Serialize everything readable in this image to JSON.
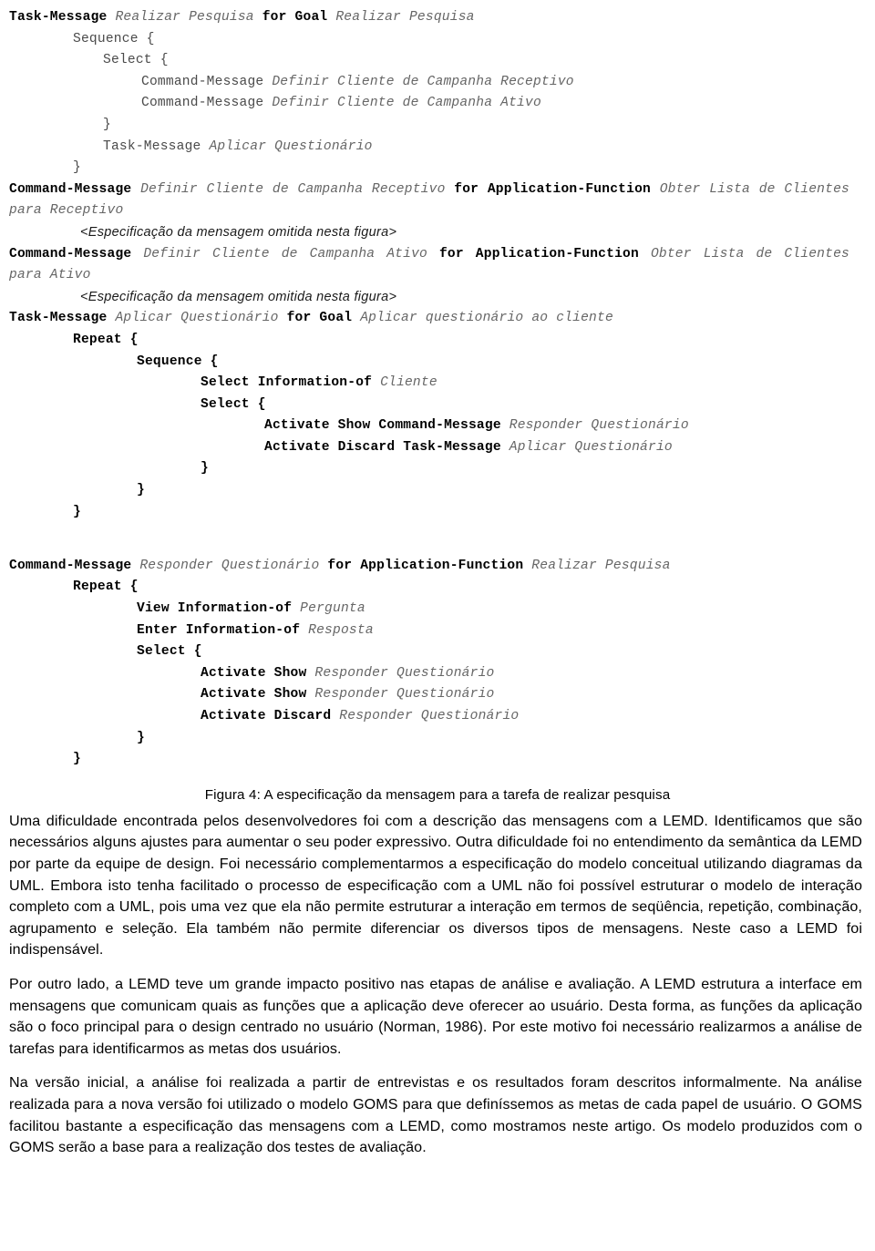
{
  "document": {
    "figure_caption": "Figura 4: A especificação da mensagem para a tarefa de realizar pesquisa",
    "omitted_note": "<Especificação da mensagem omitida nesta figura>"
  },
  "spec": {
    "blocks": [
      {
        "id": "block-task-realizar-pesquisa",
        "lines": [
          {
            "indent": 0,
            "segments": [
              {
                "t": "kw",
                "v": "Task-Message"
              },
              {
                "t": "val",
                "v": " Realizar Pesquisa "
              },
              {
                "t": "kw",
                "v": "for Goal"
              },
              {
                "t": "val",
                "v": " Realizar Pesquisa"
              }
            ]
          },
          {
            "indent": 70,
            "segments": [
              {
                "t": "plain",
                "v": "Sequence {"
              }
            ]
          },
          {
            "indent": 103,
            "segments": [
              {
                "t": "plain",
                "v": "Select {"
              }
            ]
          },
          {
            "indent": 145,
            "segments": [
              {
                "t": "plain",
                "v": "Command-Message "
              },
              {
                "t": "val",
                "v": "Definir Cliente de Campanha Receptivo"
              }
            ]
          },
          {
            "indent": 145,
            "segments": [
              {
                "t": "plain",
                "v": "Command-Message "
              },
              {
                "t": "val",
                "v": "Definir Cliente de Campanha Ativo"
              }
            ]
          },
          {
            "indent": 103,
            "segments": [
              {
                "t": "plain",
                "v": "}"
              }
            ]
          },
          {
            "indent": 103,
            "segments": [
              {
                "t": "plain",
                "v": "Task-Message "
              },
              {
                "t": "val",
                "v": "Aplicar Questionário"
              }
            ]
          },
          {
            "indent": 70,
            "segments": [
              {
                "t": "plain",
                "v": "}"
              }
            ]
          }
        ]
      }
    ],
    "line_cm1": {
      "segments": [
        {
          "t": "kw",
          "v": "Command-Message"
        },
        {
          "t": "val",
          "v": " Definir Cliente de Campanha Receptivo "
        },
        {
          "t": "kw",
          "v": "for Application-Function"
        },
        {
          "t": "val",
          "v": " Obter Lista de Clientes para Receptivo"
        }
      ]
    },
    "line_cm2": {
      "segments": [
        {
          "t": "kw",
          "v": "Command-Message"
        },
        {
          "t": "val",
          "v": " Definir Cliente de Campanha Ativo "
        },
        {
          "t": "kw",
          "v": "for Application-Function"
        },
        {
          "t": "val",
          "v": " Obter Lista de Clientes para Ativo"
        }
      ]
    },
    "block_aplicar": {
      "header": {
        "segments": [
          {
            "t": "kw",
            "v": "Task-Message"
          },
          {
            "t": "val",
            "v": " Aplicar Questionário "
          },
          {
            "t": "kw",
            "v": "for Goal"
          },
          {
            "t": "val",
            "v": " Aplicar questionário ao cliente"
          }
        ]
      },
      "lines": [
        {
          "indent": 70,
          "segments": [
            {
              "t": "kw",
              "v": "Repeat {"
            }
          ]
        },
        {
          "indent": 140,
          "segments": [
            {
              "t": "kw",
              "v": "Sequence {"
            }
          ]
        },
        {
          "indent": 210,
          "segments": [
            {
              "t": "kw",
              "v": "Select Information-of"
            },
            {
              "t": "val",
              "v": " Cliente"
            }
          ]
        },
        {
          "indent": 210,
          "segments": [
            {
              "t": "kw",
              "v": "Select {"
            }
          ]
        },
        {
          "indent": 280,
          "segments": [
            {
              "t": "kw",
              "v": "Activate Show Command-Message"
            },
            {
              "t": "val",
              "v": " Responder Questionário"
            }
          ]
        },
        {
          "indent": 280,
          "segments": [
            {
              "t": "kw",
              "v": "Activate Discard Task-Message"
            },
            {
              "t": "val",
              "v": " Aplicar Questionário"
            }
          ]
        },
        {
          "indent": 210,
          "segments": [
            {
              "t": "kw",
              "v": "}"
            }
          ]
        },
        {
          "indent": 140,
          "segments": [
            {
              "t": "kw",
              "v": "}"
            }
          ]
        },
        {
          "indent": 70,
          "segments": [
            {
              "t": "kw",
              "v": "}"
            }
          ]
        }
      ]
    },
    "block_responder": {
      "header": {
        "segments": [
          {
            "t": "kw",
            "v": "Command-Message"
          },
          {
            "t": "val",
            "v": " Responder Questionário "
          },
          {
            "t": "kw",
            "v": "for Application-Function"
          },
          {
            "t": "val",
            "v": " Realizar Pesquisa"
          }
        ]
      },
      "lines": [
        {
          "indent": 70,
          "segments": [
            {
              "t": "kw",
              "v": "Repeat {"
            }
          ]
        },
        {
          "indent": 140,
          "segments": [
            {
              "t": "kw",
              "v": "View Information-of"
            },
            {
              "t": "val",
              "v": " Pergunta"
            }
          ]
        },
        {
          "indent": 140,
          "segments": [
            {
              "t": "kw",
              "v": "Enter Information-of"
            },
            {
              "t": "val",
              "v": " Resposta"
            }
          ]
        },
        {
          "indent": 140,
          "segments": [
            {
              "t": "kw",
              "v": "Select {"
            }
          ]
        },
        {
          "indent": 210,
          "segments": [
            {
              "t": "kw",
              "v": "Activate Show"
            },
            {
              "t": "val",
              "v": " Responder Questionário"
            }
          ]
        },
        {
          "indent": 210,
          "segments": [
            {
              "t": "kw",
              "v": "Activate Show"
            },
            {
              "t": "val",
              "v": " Responder Questionário"
            }
          ]
        },
        {
          "indent": 210,
          "segments": [
            {
              "t": "kw",
              "v": "Activate Discard"
            },
            {
              "t": "val",
              "v": " Responder Questionário"
            }
          ]
        },
        {
          "indent": 140,
          "segments": [
            {
              "t": "kw",
              "v": "}"
            }
          ]
        },
        {
          "indent": 70,
          "segments": [
            {
              "t": "kw",
              "v": "}"
            }
          ]
        }
      ]
    }
  },
  "paragraphs": [
    "Uma dificuldade encontrada pelos desenvolvedores foi com a descrição das mensagens com a LEMD. Identificamos que são necessários alguns ajustes para aumentar o seu poder expressivo. Outra dificuldade foi no entendimento da semântica da LEMD por parte da equipe de design. Foi necessário complementarmos a especificação do modelo conceitual utilizando diagramas da UML. Embora isto tenha facilitado o processo de especificação com a UML não foi possível estruturar o modelo de interação completo com a UML, pois uma vez que ela não permite estruturar a interação em termos de seqüência, repetição, combinação, agrupamento e seleção. Ela também não permite diferenciar os diversos tipos de mensagens. Neste caso a LEMD foi indispensável.",
    "Por outro lado, a LEMD teve um grande impacto positivo nas etapas de análise e avaliação. A LEMD estrutura a interface em mensagens que comunicam quais as funções que a aplicação deve oferecer ao usuário. Desta forma, as funções da aplicação são o foco principal para o design centrado no usuário (Norman, 1986). Por este motivo foi necessário realizarmos a análise de tarefas para identificarmos as metas dos usuários.",
    "Na versão inicial, a análise foi realizada a partir de entrevistas e os resultados foram descritos informalmente. Na análise realizada para a nova versão foi utilizado o modelo GOMS para que definíssemos as metas de cada papel de usuário. O GOMS facilitou bastante a especificação das mensagens com a LEMD, como mostramos neste artigo. Os modelo produzidos com o GOMS serão a base para a realização dos testes de avaliação."
  ]
}
